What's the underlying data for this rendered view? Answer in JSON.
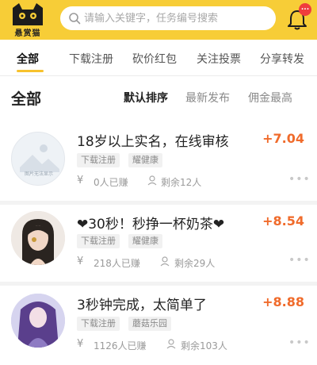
{
  "header": {
    "logo_text": "悬赏猫",
    "search_placeholder": "请输入关键字，任务编号搜索",
    "notification_badge": "..."
  },
  "tabs": [
    {
      "label": "全部",
      "active": true
    },
    {
      "label": "下载注册",
      "active": false
    },
    {
      "label": "砍价红包",
      "active": false
    },
    {
      "label": "关注投票",
      "active": false
    },
    {
      "label": "分享转发",
      "active": false
    }
  ],
  "section": {
    "title": "全部",
    "sort_options": [
      {
        "label": "默认排序",
        "active": true
      },
      {
        "label": "最新发布",
        "active": false
      },
      {
        "label": "佣金最高",
        "active": false
      }
    ]
  },
  "tasks": [
    {
      "title": "18岁以上实名，在线审核",
      "reward": "+7.04",
      "tags": [
        "下载注册",
        "耀健康"
      ],
      "earned": "0人已赚",
      "remaining": "剩余12人",
      "avatar_text": "图片无法显示"
    },
    {
      "title": "❤30秒！秒挣一杯奶茶❤",
      "reward": "+8.54",
      "tags": [
        "下载注册",
        "耀健康"
      ],
      "earned": "218人已赚",
      "remaining": "剩余29人"
    },
    {
      "title": "3秒钟完成，太简单了",
      "reward": "+8.88",
      "tags": [
        "下载注册",
        "蘑菇乐园"
      ],
      "earned": "1126人已赚",
      "remaining": "剩余103人"
    }
  ],
  "icons": {
    "currency": "yen-icon",
    "user": "user-icon",
    "more": "more-dots-icon"
  },
  "colors": {
    "header_bg": "#f7cd37",
    "reward": "#f06b2b",
    "badge": "#ef3d3d",
    "tab_underline": "#f7c22d"
  },
  "more_label": "•••",
  "yen_symbol": "¥"
}
